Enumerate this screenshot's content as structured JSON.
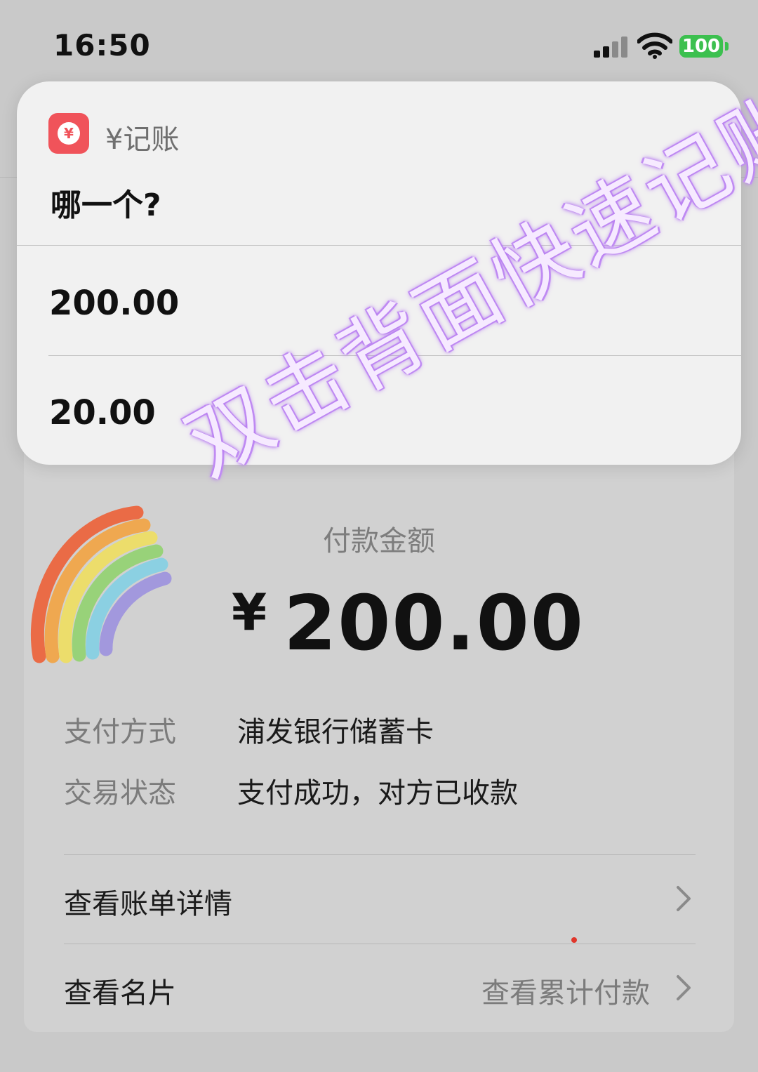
{
  "status_bar": {
    "time": "16:50",
    "battery": "100",
    "battery_color": "#3cc04f"
  },
  "receipt": {
    "amount_label": "付款金额",
    "currency": "¥",
    "amount": "200.00",
    "rows": [
      {
        "label": "支付方式",
        "value": "浦发银行储蓄卡"
      },
      {
        "label": "交易状态",
        "value": "支付成功，对方已收款"
      }
    ],
    "bill_details": "查看账单详情",
    "business_card": "查看名片",
    "cumulative_payments": "查看累计付款"
  },
  "popup": {
    "app_icon_symbol": "¥",
    "app_name": "¥记账",
    "question": "哪一个?",
    "options": [
      "200.00",
      "20.00"
    ]
  },
  "overlay_text": "双击背面快速记账",
  "icons": {
    "signal": "signal-icon",
    "wifi": "wifi-icon",
    "battery": "battery-icon",
    "app": "yen-app-icon",
    "chevron": "chevron-right-icon",
    "sticker": "rainbow-sticker"
  },
  "colors": {
    "accent_red": "#f0535a",
    "watermark_glow": "#b77cf0"
  }
}
